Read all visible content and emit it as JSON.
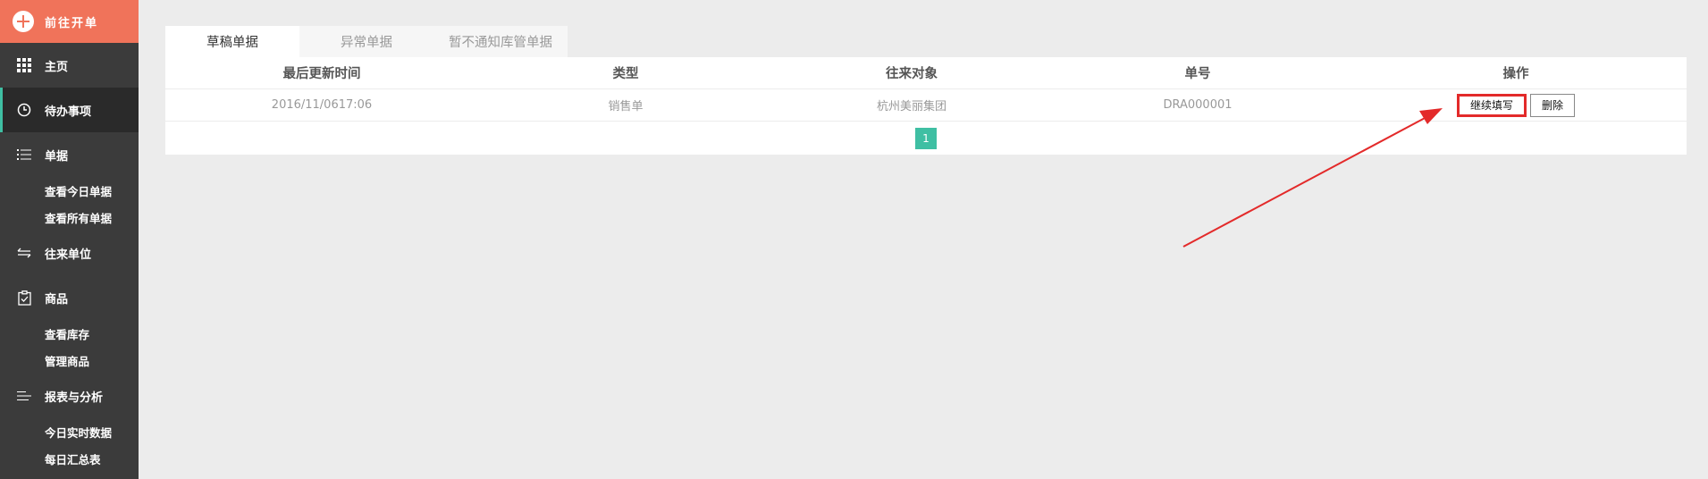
{
  "sidebar": {
    "new_order_label": "前往开单",
    "items": [
      {
        "label": "主页"
      },
      {
        "label": "待办事项"
      },
      {
        "label": "单据"
      },
      {
        "label": "查看今日单据"
      },
      {
        "label": "查看所有单据"
      },
      {
        "label": "往来单位"
      },
      {
        "label": "商品"
      },
      {
        "label": "查看库存"
      },
      {
        "label": "管理商品"
      },
      {
        "label": "报表与分析"
      },
      {
        "label": "今日实时数据"
      },
      {
        "label": "每日汇总表"
      }
    ]
  },
  "tabs": [
    {
      "label": "草稿单据"
    },
    {
      "label": "异常单据"
    },
    {
      "label": "暂不通知库管单据"
    }
  ],
  "table": {
    "headers": [
      "最后更新时间",
      "类型",
      "往来对象",
      "单号",
      "操作"
    ],
    "rows": [
      {
        "updated": "2016/11/0617:06",
        "type": "销售单",
        "counterparty": "杭州美丽集团",
        "number": "DRA000001"
      }
    ],
    "actions": {
      "continue": "继续填写",
      "delete": "删除"
    }
  },
  "pagination": {
    "current": "1"
  },
  "colors": {
    "accent": "#3fbfa3",
    "new_order": "#f0735a",
    "sidebar_bg": "#3b3b3b",
    "highlight": "#e32a2a"
  }
}
